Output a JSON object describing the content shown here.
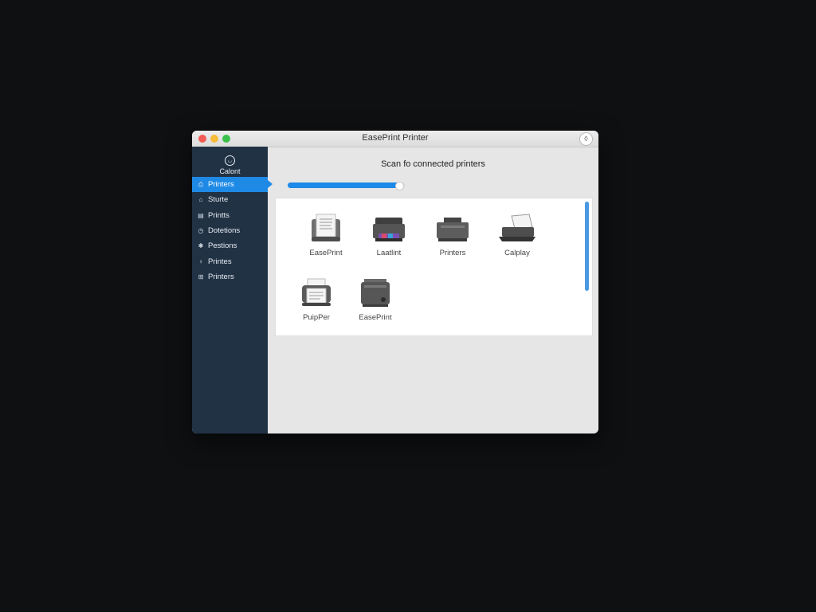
{
  "window": {
    "title": "EasePrint Printer"
  },
  "sidebar": {
    "account": {
      "icon": "account-icon",
      "label": "Calont"
    },
    "items": [
      {
        "label": "Printers",
        "icon": "printer-icon",
        "active": true
      },
      {
        "label": "Sturte",
        "icon": "home-icon"
      },
      {
        "label": "Printts",
        "icon": "document-icon"
      },
      {
        "label": "Dotetions",
        "icon": "clock-icon"
      },
      {
        "label": "Pestions",
        "icon": "star-icon"
      },
      {
        "label": "Printes",
        "icon": "user-icon"
      },
      {
        "label": "Printers",
        "icon": "grid-icon"
      }
    ]
  },
  "main": {
    "scan_title": "Scan fo connected printers",
    "progress": 0.95,
    "printers": [
      {
        "label": "EasePrint",
        "icon": "printer-document-icon"
      },
      {
        "label": "Laatlint",
        "icon": "inkjet-printer-icon"
      },
      {
        "label": "Printers",
        "icon": "laser-printer-icon"
      },
      {
        "label": "Calplay",
        "icon": "scanner-printer-icon"
      },
      {
        "label": "PuipPer",
        "icon": "printer-paper-icon"
      },
      {
        "label": "EasePrint",
        "icon": "office-printer-icon"
      }
    ]
  },
  "colors": {
    "sidebar_bg": "#223245",
    "accent": "#1f8ae6",
    "content_bg": "#e6e6e6"
  }
}
